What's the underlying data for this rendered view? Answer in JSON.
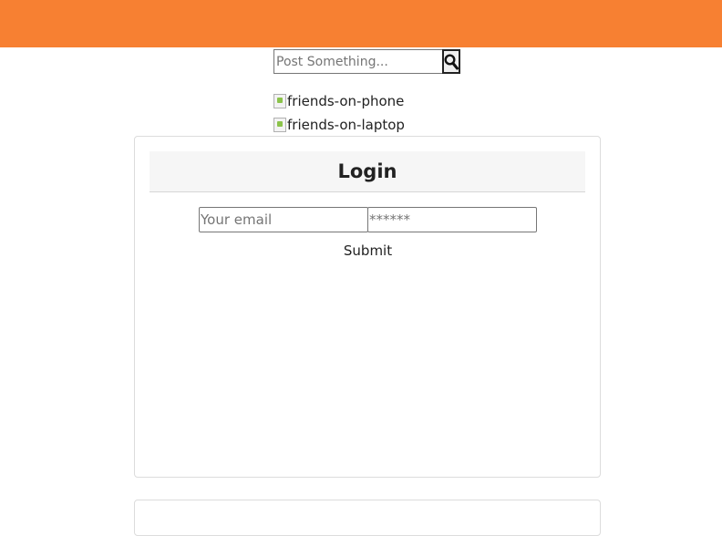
{
  "search": {
    "placeholder": "Post Something...",
    "button_icon": "search-icon"
  },
  "images": [
    {
      "alt": "friends-on-phone"
    },
    {
      "alt": "friends-on-laptop"
    }
  ],
  "login": {
    "title": "Login",
    "email_placeholder": "Your email",
    "password_placeholder": "******",
    "submit_label": "Submit"
  },
  "colors": {
    "topbar": "#f78032"
  }
}
